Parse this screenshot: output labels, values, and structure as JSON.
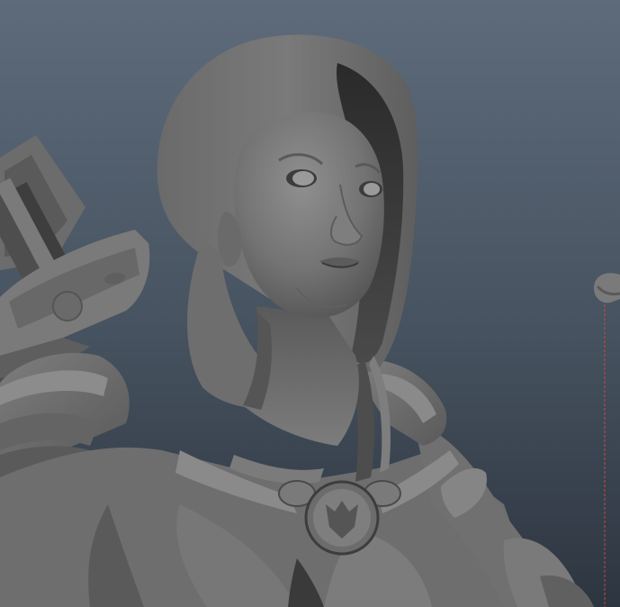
{
  "scene": {
    "subject": "",
    "background_gradient": {
      "top": "#5b6878",
      "mid": "#445060",
      "bottom": "#2f3843"
    },
    "colors": {
      "clay_light": "#8a8a8a",
      "clay_mid": "#6f6f6f",
      "clay_dark": "#4a4a4a",
      "clay_shadow": "#2e2e2e",
      "bowstring": "#c94a3a"
    }
  }
}
